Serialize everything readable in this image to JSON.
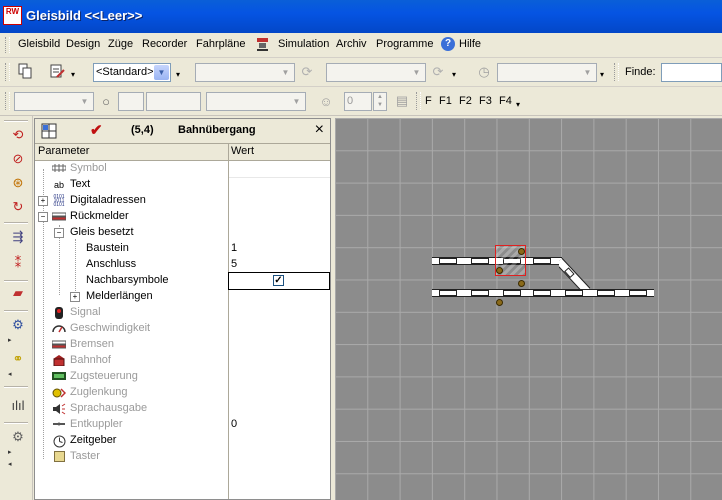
{
  "window": {
    "title": "Gleisbild <<Leer>>",
    "logo_text": "RW"
  },
  "menu": [
    "Gleisbild",
    "Design",
    "Züge",
    "Recorder",
    "Fahrpläne",
    "Simulation",
    "Archiv",
    "Programme",
    "Hilfe"
  ],
  "toolbar1": {
    "style_combo": "<Standard>",
    "find_label": "Finde:",
    "find_value": ""
  },
  "toolbar2": {
    "spin_value": "0",
    "fkeys": [
      "F",
      "F1",
      "F2",
      "F3",
      "F4"
    ]
  },
  "panel": {
    "coord": "(5,4)",
    "title": "Bahnübergang",
    "col_param": "Parameter",
    "col_value": "Wert",
    "rows": [
      {
        "label": "Symbol",
        "value": "",
        "icon": "track-icon"
      },
      {
        "label": "Text",
        "value": "",
        "icon": "text-icon",
        "icon_text": "ab"
      },
      {
        "label": "Digitaladressen",
        "value": "",
        "icon": "binary-icon"
      },
      {
        "label": "Rückmelder",
        "value": "",
        "icon": "feedback-icon"
      },
      {
        "label": "Gleis besetzt",
        "value": ""
      },
      {
        "label": "Baustein",
        "value": "1"
      },
      {
        "label": "Anschluss",
        "value": "5"
      },
      {
        "label": "Nachbarsymbole",
        "value": "",
        "checked": true
      },
      {
        "label": "Melderlängen",
        "value": ""
      },
      {
        "label": "Signal",
        "value": "",
        "icon": "signal-icon"
      },
      {
        "label": "Geschwindigkeit",
        "value": "",
        "icon": "speed-icon"
      },
      {
        "label": "Bremsen",
        "value": "",
        "icon": "brake-icon"
      },
      {
        "label": "Bahnhof",
        "value": "",
        "icon": "station-icon"
      },
      {
        "label": "Zugsteuerung",
        "value": "",
        "icon": "train-control-icon"
      },
      {
        "label": "Zuglenkung",
        "value": "",
        "icon": "route-icon"
      },
      {
        "label": "Sprachausgabe",
        "value": "",
        "icon": "speaker-icon"
      },
      {
        "label": "Entkuppler",
        "value": "0",
        "icon": "uncoupler-icon"
      },
      {
        "label": "Zeitgeber",
        "value": "",
        "icon": "timer-icon"
      },
      {
        "label": "Taster",
        "value": "",
        "icon": "button-icon"
      }
    ]
  },
  "colors": {
    "accent": "#0554e3",
    "selection": "#e02020",
    "canvas": "#8c8c8c"
  }
}
